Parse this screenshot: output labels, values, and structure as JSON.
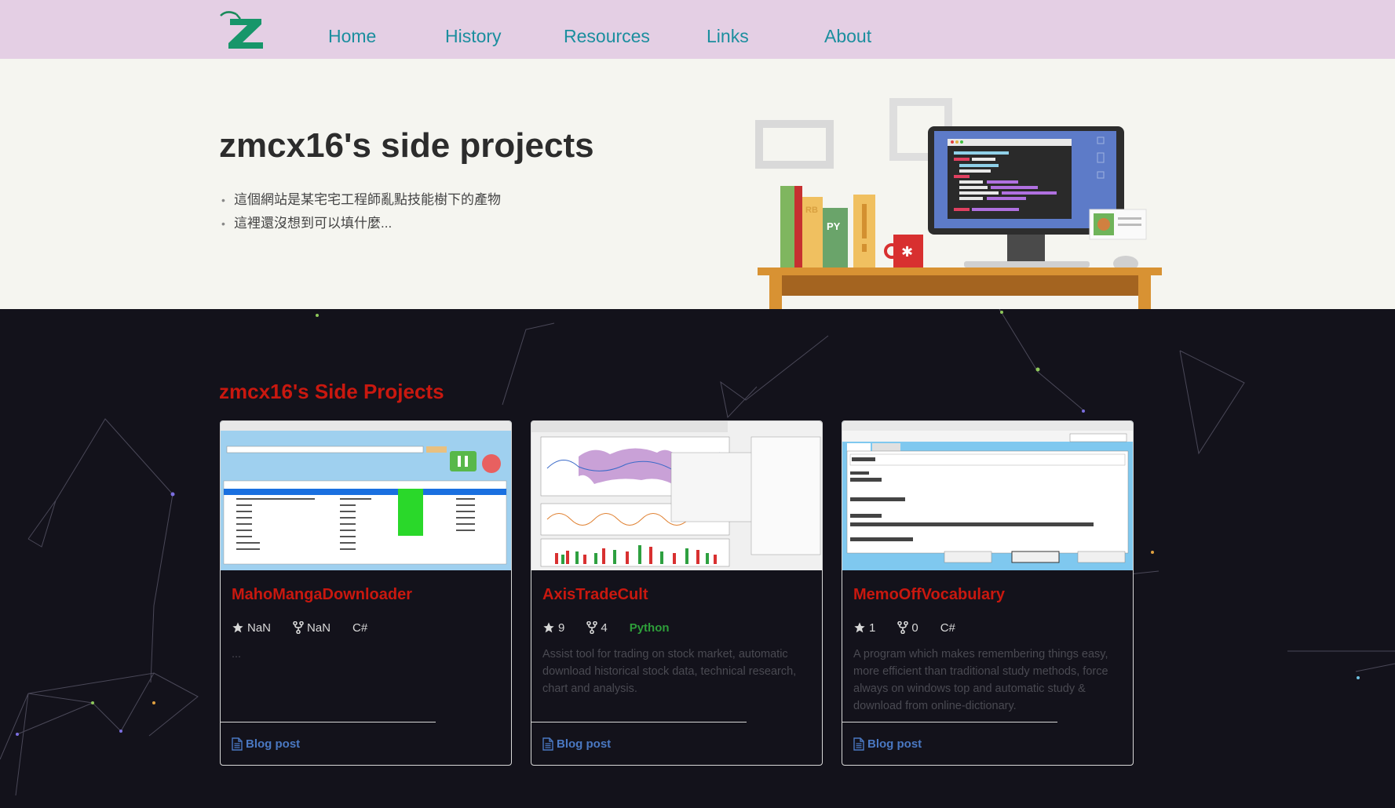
{
  "nav": {
    "logo_letter": "Z",
    "links": [
      {
        "label": "Home"
      },
      {
        "label": "History"
      },
      {
        "label": "Resources"
      },
      {
        "label": "Links"
      },
      {
        "label": "About"
      }
    ]
  },
  "hero": {
    "title": "zmcx16's side projects",
    "bullets": [
      "這個網站是某宅宅工程師亂點技能樹下的產物",
      "這裡還沒想到可以填什麼..."
    ],
    "illustration_labels": {
      "book_rb": "RB",
      "book_py": "PY"
    }
  },
  "projects": {
    "section_title": "zmcx16's Side Projects",
    "blog_label": "Blog post",
    "cards": [
      {
        "title": "MahoMangaDownloader",
        "stars": "NaN",
        "forks": "NaN",
        "language": "C#",
        "language_color": "#d8d8d8",
        "description": "..."
      },
      {
        "title": "AxisTradeCult",
        "stars": "9",
        "forks": "4",
        "language": "Python",
        "language_color": "#2e9e3a",
        "description": "Assist tool for trading on stock market, automatic download historical stock data, technical research, chart and analysis."
      },
      {
        "title": "MemoOffVocabulary",
        "stars": "1",
        "forks": "0",
        "language": "C#",
        "language_color": "#d8d8d8",
        "description": "A program which makes remembering things easy, more efficient than traditional study methods, force always on windows top and automatic study & download from online-dictionary."
      }
    ]
  },
  "colors": {
    "nav_bg": "#e4cfe4",
    "nav_link": "#1b8e9e",
    "accent_red": "#c9180f",
    "blog_link": "#4a78c2",
    "dark_bg": "#13121b"
  }
}
